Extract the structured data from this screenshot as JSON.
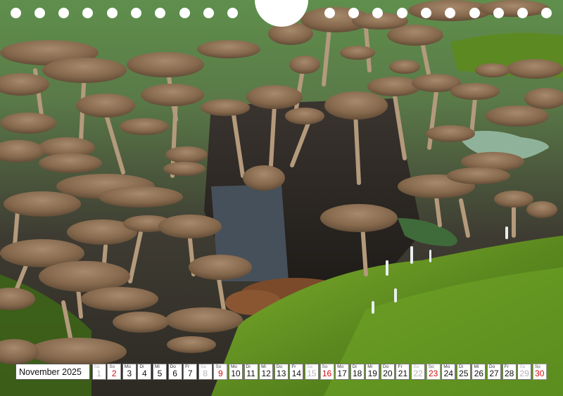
{
  "calendar": {
    "month_label": "November 2025",
    "days": [
      {
        "wd": "Sa",
        "num": "1",
        "type": "sat"
      },
      {
        "wd": "So",
        "num": "2",
        "type": "sun"
      },
      {
        "wd": "Mo",
        "num": "3",
        "type": "week"
      },
      {
        "wd": "Di",
        "num": "4",
        "type": "week"
      },
      {
        "wd": "Mi",
        "num": "5",
        "type": "week"
      },
      {
        "wd": "Do",
        "num": "6",
        "type": "week"
      },
      {
        "wd": "Fr",
        "num": "7",
        "type": "week"
      },
      {
        "wd": "Sa",
        "num": "8",
        "type": "sat"
      },
      {
        "wd": "So",
        "num": "9",
        "type": "sun"
      },
      {
        "wd": "Mo",
        "num": "10",
        "type": "week"
      },
      {
        "wd": "Di",
        "num": "11",
        "type": "week"
      },
      {
        "wd": "Mi",
        "num": "12",
        "type": "week"
      },
      {
        "wd": "Do",
        "num": "13",
        "type": "week"
      },
      {
        "wd": "Fr",
        "num": "14",
        "type": "week"
      },
      {
        "wd": "Sa",
        "num": "15",
        "type": "sat"
      },
      {
        "wd": "So",
        "num": "16",
        "type": "sun"
      },
      {
        "wd": "Mo",
        "num": "17",
        "type": "week"
      },
      {
        "wd": "Di",
        "num": "18",
        "type": "week"
      },
      {
        "wd": "Mi",
        "num": "19",
        "type": "week"
      },
      {
        "wd": "Do",
        "num": "20",
        "type": "week"
      },
      {
        "wd": "Fr",
        "num": "21",
        "type": "week"
      },
      {
        "wd": "Sa",
        "num": "22",
        "type": "sat"
      },
      {
        "wd": "So",
        "num": "23",
        "type": "sun"
      },
      {
        "wd": "Mo",
        "num": "24",
        "type": "week"
      },
      {
        "wd": "Di",
        "num": "25",
        "type": "week"
      },
      {
        "wd": "Mi",
        "num": "26",
        "type": "week"
      },
      {
        "wd": "Do",
        "num": "27",
        "type": "week"
      },
      {
        "wd": "Fr",
        "num": "28",
        "type": "week"
      },
      {
        "wd": "Sa",
        "num": "29",
        "type": "sat"
      },
      {
        "wd": "So",
        "num": "30",
        "type": "sun"
      }
    ]
  },
  "colors": {
    "sunday": "#d10f0f",
    "saturday": "#b5b5b5",
    "moss": "#5d8a1f",
    "mushroom_cap": "#8a6e52"
  }
}
